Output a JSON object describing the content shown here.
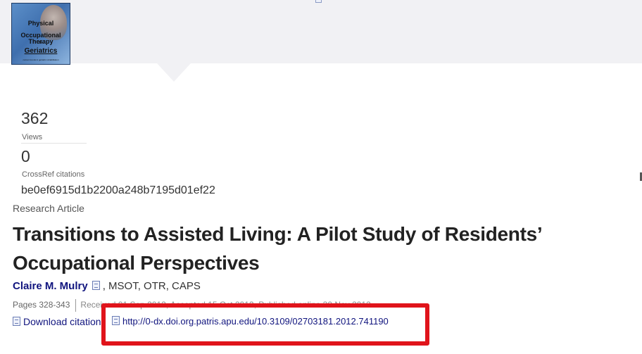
{
  "journal": {
    "cover_line1": "Physical",
    "cover_line2": "Occupational Therapy",
    "cover_line3": "in",
    "cover_line4": "Geriatrics",
    "cover_line5": "current trends in geriatric rehabilitation"
  },
  "metrics": {
    "views_count": "362",
    "views_label": "Views",
    "crossref_count": "0",
    "crossref_label": "CrossRef citations",
    "hash": "be0ef6915d1b2200a248b7195d01ef22"
  },
  "article": {
    "type": "Research Article",
    "title": "Transitions to Assisted Living: A Pilot Study of Residents’ Occupational Perspectives",
    "author_name": "Claire M. Mulry",
    "author_credentials": ", MSOT, OTR, CAPS",
    "pages": "Pages 328-343",
    "received": "Received 01 Sep 2012, Accepted 15 Oct 2012, Published online 30 Nov 2012"
  },
  "actions": {
    "download_citation": "Download citation",
    "doi_url": "http://0-dx.doi.org.patris.apu.edu/10.3109/02703181.2012.741190"
  },
  "colors": {
    "link": "#10147e",
    "highlight": "#e0141b",
    "band": "#f1f1f4"
  }
}
